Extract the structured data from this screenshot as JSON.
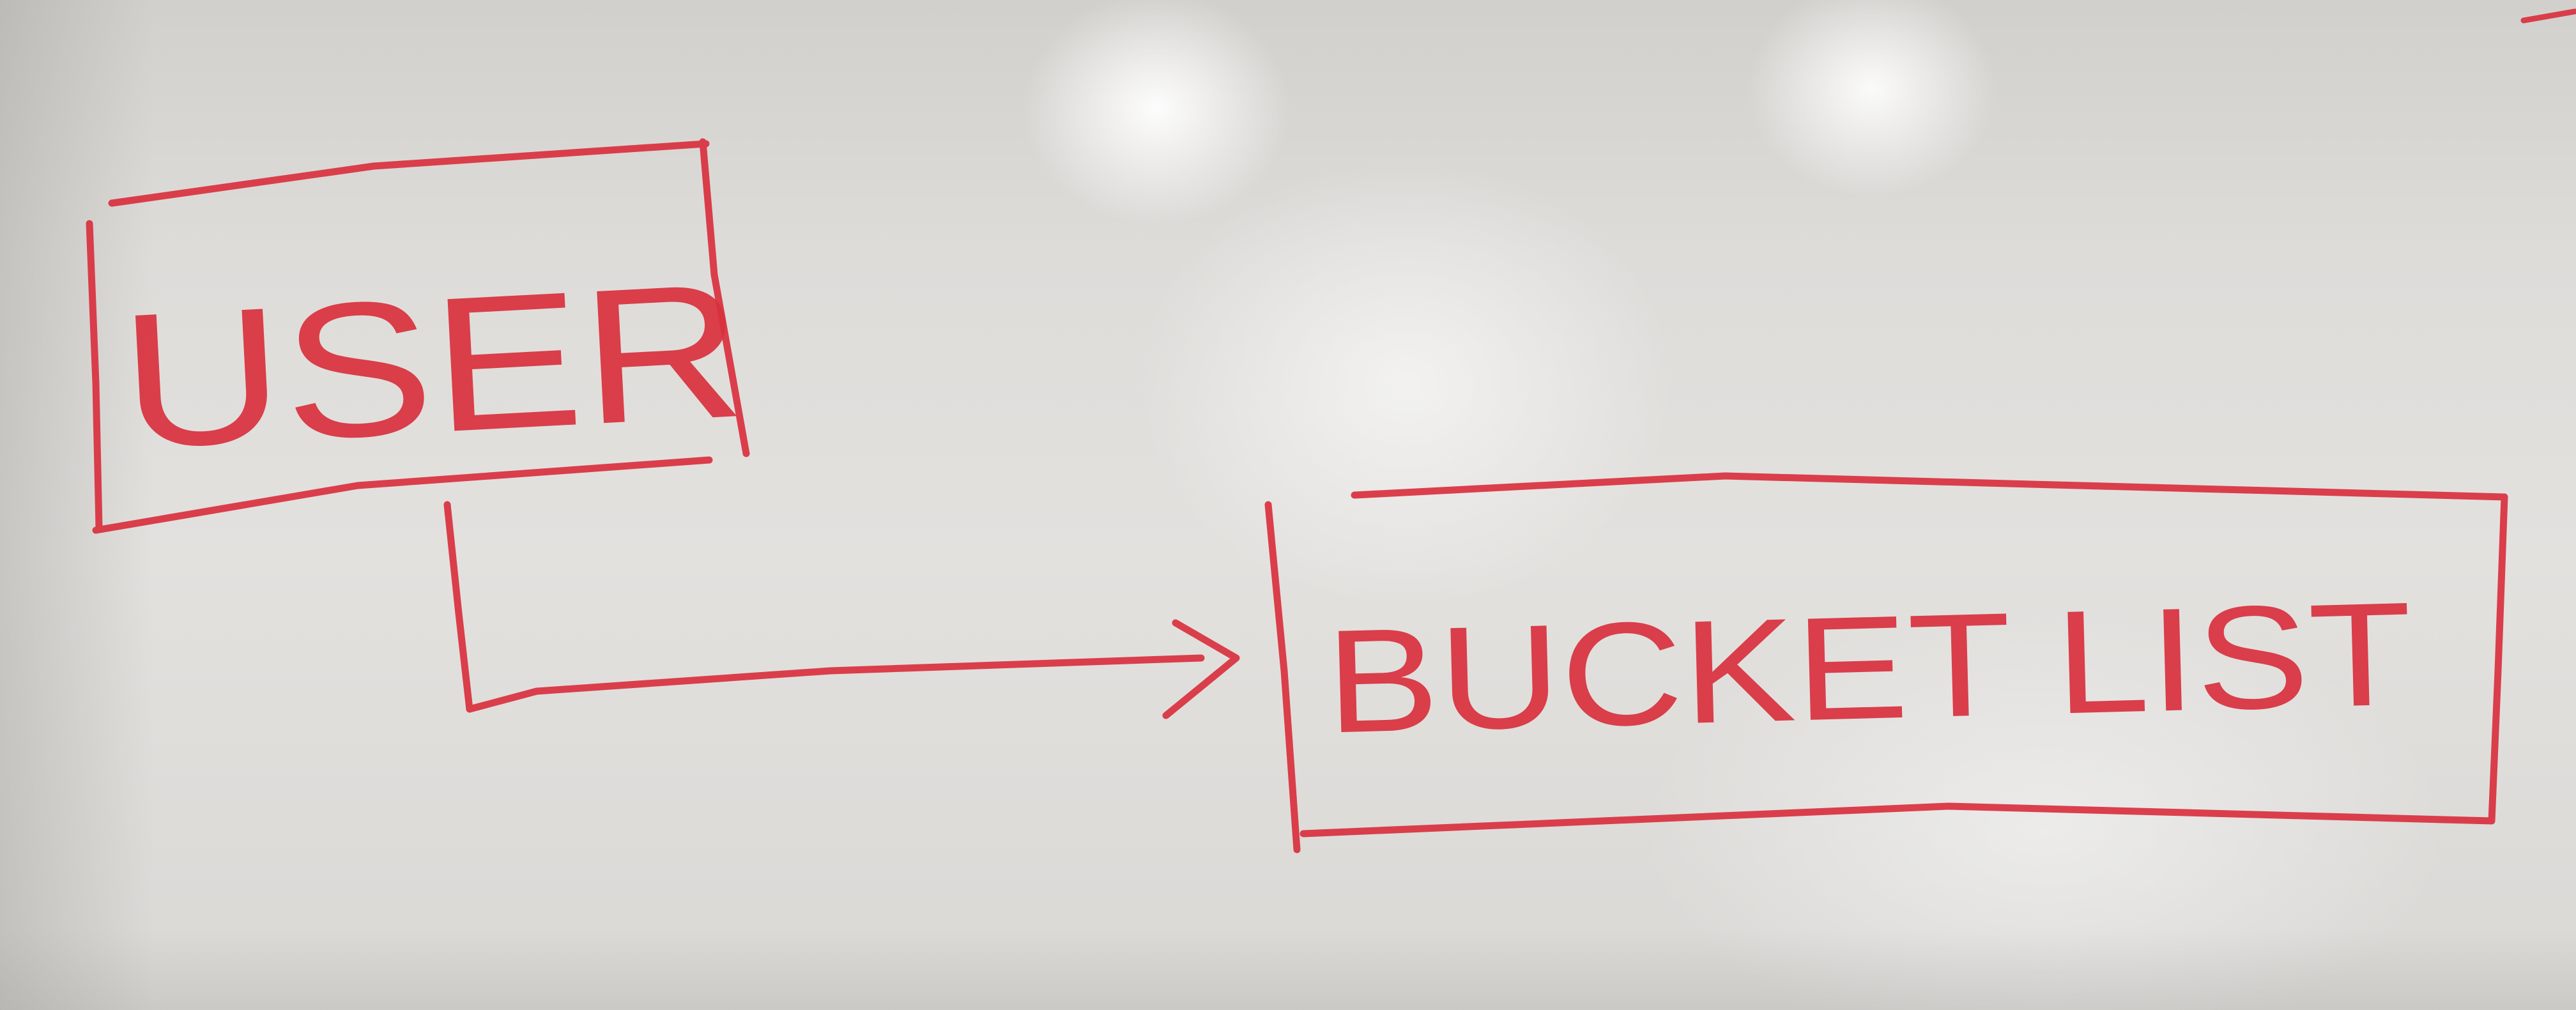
{
  "diagram": {
    "nodes": [
      {
        "id": "user",
        "label": "USER"
      },
      {
        "id": "bucket-list",
        "label": "BUCKET LIST"
      }
    ],
    "edges": [
      {
        "from": "user",
        "to": "bucket-list"
      }
    ]
  },
  "colors": {
    "marker": "#d9323f",
    "board": "#e0dedb"
  }
}
